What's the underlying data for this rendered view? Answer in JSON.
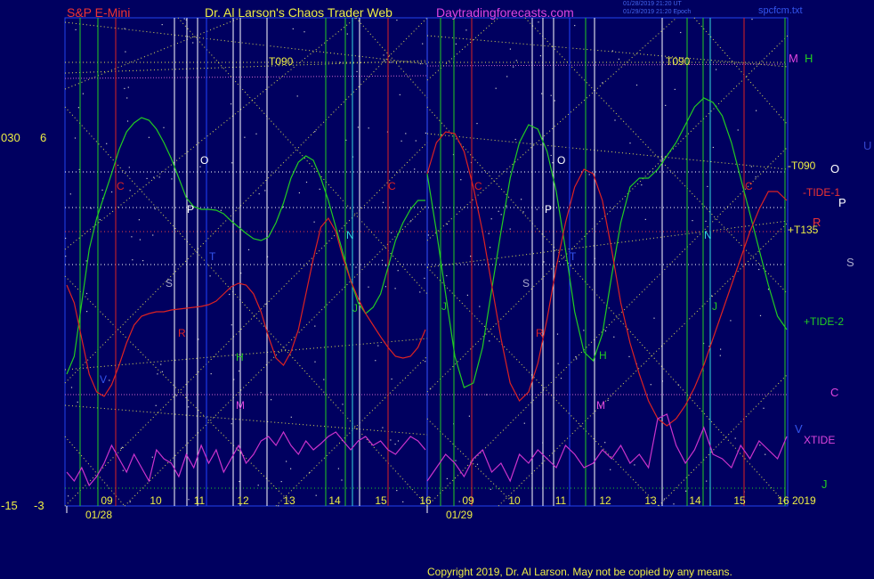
{
  "header": {
    "symbol": "S&P E-Mini",
    "web_title": "Dr. Al Larson's Chaos Trader Web",
    "site": "Daytradingforecasts.com",
    "file_tag": "spcfcm.txt",
    "stamp_line1": "01/28/2019 21:20 UT",
    "stamp_line2": "01/29/2019 21:20 Epoch"
  },
  "footer": {
    "copyright": "Copyright 2019, Dr. Al Larson. May not be copied by any means.",
    "year": "2019"
  },
  "left_axis": {
    "top_a": "030",
    "top_b": "6",
    "bottom_a": "-15",
    "bottom_b": "-3"
  },
  "right_labels": {
    "m": "M",
    "h": "H",
    "t090": "-T090",
    "o": "O",
    "tide1": "-TIDE-1",
    "p": "P",
    "r": "R",
    "t135": "+T135",
    "u": "U",
    "s": "S",
    "tide2": "+TIDE-2",
    "c": "C",
    "v": "V",
    "xtide": "XTIDE",
    "j": "J"
  },
  "colors": {
    "background": "#000060",
    "frame": "#2244ee",
    "green_wave": "#22cc22",
    "red_wave": "#dd2222",
    "xtide": "#cc33cc",
    "grid_dots": "#dddd55",
    "header_red": "#ee3333",
    "header_yellow": "#eeee44",
    "header_magenta": "#dd44dd"
  },
  "chart_data": {
    "type": "line",
    "title": "S&P E-Mini",
    "x_ticks": [
      "09",
      "10",
      "11",
      "12",
      "13",
      "14",
      "15",
      "16",
      "09",
      "10",
      "11",
      "12",
      "13",
      "14",
      "15",
      "16"
    ],
    "date_labels": [
      "01/28",
      "01/29"
    ],
    "series": [
      {
        "name": "+TIDE-2",
        "color": "#22cc22",
        "values": [
          420,
          400,
          340,
          280,
          245,
          220,
          195,
          168,
          148,
          138,
          132,
          135,
          145,
          160,
          178,
          200,
          222,
          232,
          235,
          235,
          236,
          240,
          248,
          255,
          262,
          268,
          270,
          266,
          250,
          228,
          200,
          182,
          175,
          180,
          200,
          225,
          255,
          285,
          315,
          340,
          352,
          345,
          330,
          300,
          270,
          250,
          235,
          225,
          225,
          195,
          260,
          330,
          400,
          435,
          430,
          390,
          325,
          260,
          200,
          160,
          140,
          145,
          170,
          215,
          280,
          350,
          395,
          405,
          375,
          310,
          250,
          210,
          200,
          200,
          190,
          175,
          160,
          140,
          120,
          110,
          115,
          130,
          160,
          200,
          240,
          280,
          320,
          355,
          370
        ]
      },
      {
        "name": "-TIDE-1",
        "color": "#dd2222",
        "values": [
          320,
          340,
          380,
          420,
          440,
          445,
          432,
          410,
          385,
          365,
          355,
          352,
          350,
          350,
          348,
          347,
          346,
          345,
          344,
          342,
          338,
          330,
          322,
          318,
          320,
          330,
          350,
          378,
          402,
          410,
          395,
          370,
          330,
          290,
          255,
          245,
          260,
          290,
          315,
          335,
          352,
          365,
          378,
          390,
          400,
          402,
          400,
          390,
          370,
          195,
          160,
          148,
          150,
          170,
          210,
          260,
          320,
          380,
          430,
          450,
          440,
          408,
          358,
          300,
          250,
          210,
          190,
          195,
          225,
          280,
          340,
          385,
          420,
          450,
          470,
          478,
          470,
          455,
          435,
          410,
          380,
          350,
          320,
          290,
          260,
          235,
          215,
          215,
          225
        ]
      },
      {
        "name": "XTIDE",
        "color": "#cc33cc",
        "values": [
          530,
          540,
          525,
          545,
          535,
          520,
          500,
          515,
          530,
          510,
          525,
          540,
          505,
          515,
          520,
          535,
          510,
          525,
          500,
          520,
          505,
          530,
          515,
          500,
          520,
          510,
          495,
          490,
          500,
          485,
          500,
          510,
          495,
          505,
          498,
          490,
          485,
          495,
          505,
          495,
          490,
          500,
          495,
          505,
          510,
          500,
          490,
          495,
          505,
          540,
          525,
          510,
          520,
          535,
          515,
          505,
          530,
          520,
          540,
          510,
          520,
          505,
          515,
          525,
          500,
          510,
          525,
          520,
          505,
          515,
          500,
          520,
          510,
          525,
          470,
          465,
          500,
          520,
          505,
          480,
          510,
          515,
          525,
          500,
          515,
          495,
          505,
          515,
          490
        ]
      }
    ]
  }
}
